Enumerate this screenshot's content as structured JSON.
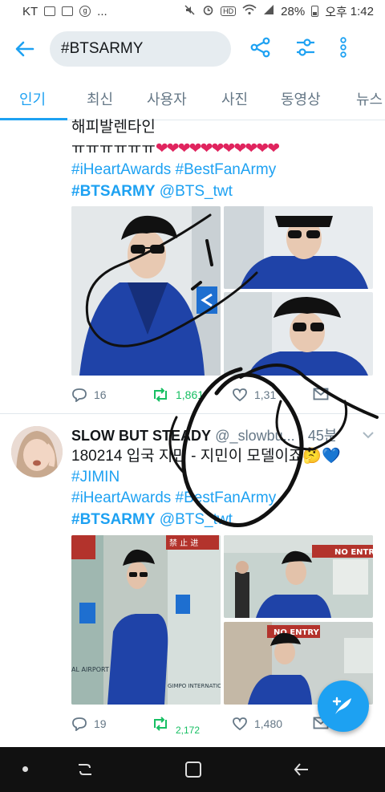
{
  "status_bar": {
    "carrier": "KT",
    "more": "...",
    "hd": "HD",
    "battery": "28%",
    "ampm": "오후",
    "time": "1:42"
  },
  "app_bar": {
    "search_value": "#BTSARMY"
  },
  "tabs": [
    {
      "label": "인기",
      "active": true
    },
    {
      "label": "최신",
      "active": false
    },
    {
      "label": "사용자",
      "active": false
    },
    {
      "label": "사진",
      "active": false
    },
    {
      "label": "동영상",
      "active": false
    },
    {
      "label": "뉴스",
      "active": false
    }
  ],
  "tweet1": {
    "line1": "해피발렌타인",
    "line2_prefix": "ㅠㅠㅠㅠㅠㅠ",
    "line2_hearts": "❤❤❤❤❤❤❤❤❤❤❤",
    "hashtags_line": "#iHeartAwards #BestFanArmy",
    "bold_tag": "#BTSARMY",
    "mention": "@BTS_twt",
    "replies": "16",
    "retweets": "1,861",
    "likes": "1,31"
  },
  "tweet2": {
    "name": "SLOW BUT STEADY",
    "handle": "@_slowbu...",
    "time": "· 45분",
    "line1": "180214 입국 지민 - 지민이 모델이죠🤔💙",
    "hashtag1": "#JIMIN",
    "hashtags_line": "#iHeartAwards #BestFanArmy",
    "bold_tag": "#BTSARMY",
    "mention": "@BTS_twt",
    "replies": "19",
    "retweets": "2,172",
    "likes": "1,480"
  },
  "photo_signs": {
    "no_entry_1": "NO ENTRY",
    "no_entry_2": "NO ENTRY",
    "airport": "AL AIRPORT",
    "gimpo": "GIMPO INTERNATIO",
    "gate": "禁 止 进"
  },
  "colors": {
    "accent": "#1da1f2",
    "retweet": "#17bf63",
    "heart": "#e0245e",
    "coat": "#1f3f9f"
  }
}
